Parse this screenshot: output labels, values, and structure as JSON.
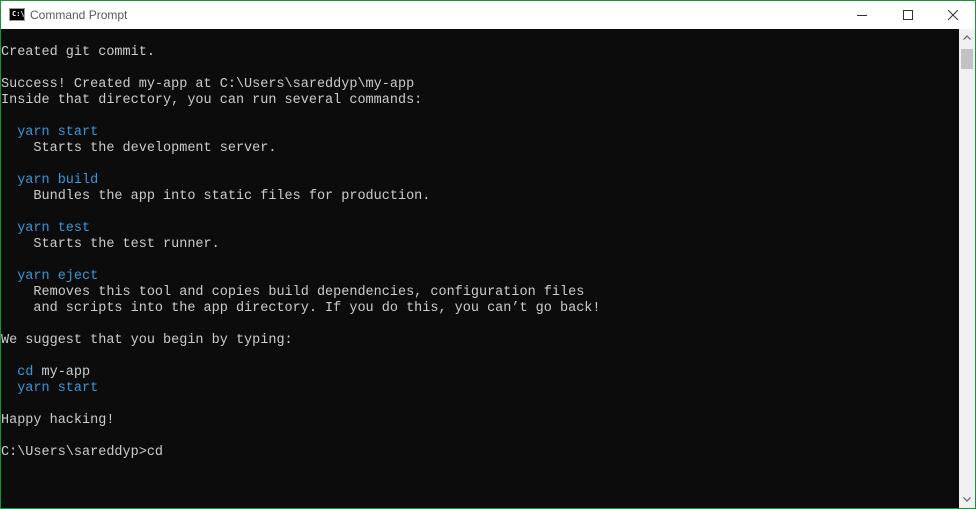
{
  "window": {
    "title": "Command Prompt",
    "icon_text": "C:\\_",
    "icon": "cmd-icon",
    "controls": [
      "minimize-icon",
      "maximize-icon",
      "close-icon"
    ]
  },
  "console": {
    "lines": [
      {
        "id": "l1",
        "prefix": "",
        "cmd": "",
        "text": "Created git commit."
      },
      {
        "id": "l2",
        "prefix": "",
        "cmd": "",
        "text": ""
      },
      {
        "id": "l3",
        "prefix": "",
        "cmd": "",
        "text": "Success! Created my-app at C:\\Users\\sareddyp\\my-app"
      },
      {
        "id": "l4",
        "prefix": "",
        "cmd": "",
        "text": "Inside that directory, you can run several commands:"
      },
      {
        "id": "l5",
        "prefix": "",
        "cmd": "",
        "text": ""
      },
      {
        "id": "l6",
        "prefix": "  ",
        "cmd": "yarn start",
        "text": ""
      },
      {
        "id": "l7",
        "prefix": "",
        "cmd": "",
        "text": "    Starts the development server."
      },
      {
        "id": "l8",
        "prefix": "",
        "cmd": "",
        "text": ""
      },
      {
        "id": "l9",
        "prefix": "  ",
        "cmd": "yarn build",
        "text": ""
      },
      {
        "id": "l10",
        "prefix": "",
        "cmd": "",
        "text": "    Bundles the app into static files for production."
      },
      {
        "id": "l11",
        "prefix": "",
        "cmd": "",
        "text": ""
      },
      {
        "id": "l12",
        "prefix": "  ",
        "cmd": "yarn test",
        "text": ""
      },
      {
        "id": "l13",
        "prefix": "",
        "cmd": "",
        "text": "    Starts the test runner."
      },
      {
        "id": "l14",
        "prefix": "",
        "cmd": "",
        "text": ""
      },
      {
        "id": "l15",
        "prefix": "  ",
        "cmd": "yarn eject",
        "text": ""
      },
      {
        "id": "l16",
        "prefix": "",
        "cmd": "",
        "text": "    Removes this tool and copies build dependencies, configuration files"
      },
      {
        "id": "l17",
        "prefix": "",
        "cmd": "",
        "text": "    and scripts into the app directory. If you do this, you can’t go back!"
      },
      {
        "id": "l18",
        "prefix": "",
        "cmd": "",
        "text": ""
      },
      {
        "id": "l19",
        "prefix": "",
        "cmd": "",
        "text": "We suggest that you begin by typing:"
      },
      {
        "id": "l20",
        "prefix": "",
        "cmd": "",
        "text": ""
      },
      {
        "id": "l21",
        "prefix": "  ",
        "cmd": "cd",
        "text": " my-app"
      },
      {
        "id": "l22",
        "prefix": "  ",
        "cmd": "yarn start",
        "text": ""
      },
      {
        "id": "l23",
        "prefix": "",
        "cmd": "",
        "text": ""
      },
      {
        "id": "l24",
        "prefix": "",
        "cmd": "",
        "text": "Happy hacking!"
      },
      {
        "id": "l25",
        "prefix": "",
        "cmd": "",
        "text": ""
      },
      {
        "id": "l26",
        "prefix": "",
        "cmd": "",
        "text": "C:\\Users\\sareddyp>cd"
      }
    ]
  },
  "colors": {
    "background": "#0c0c0c",
    "text": "#cccccc",
    "command": "#3a96dd",
    "window_border": "#1f8f3a"
  }
}
